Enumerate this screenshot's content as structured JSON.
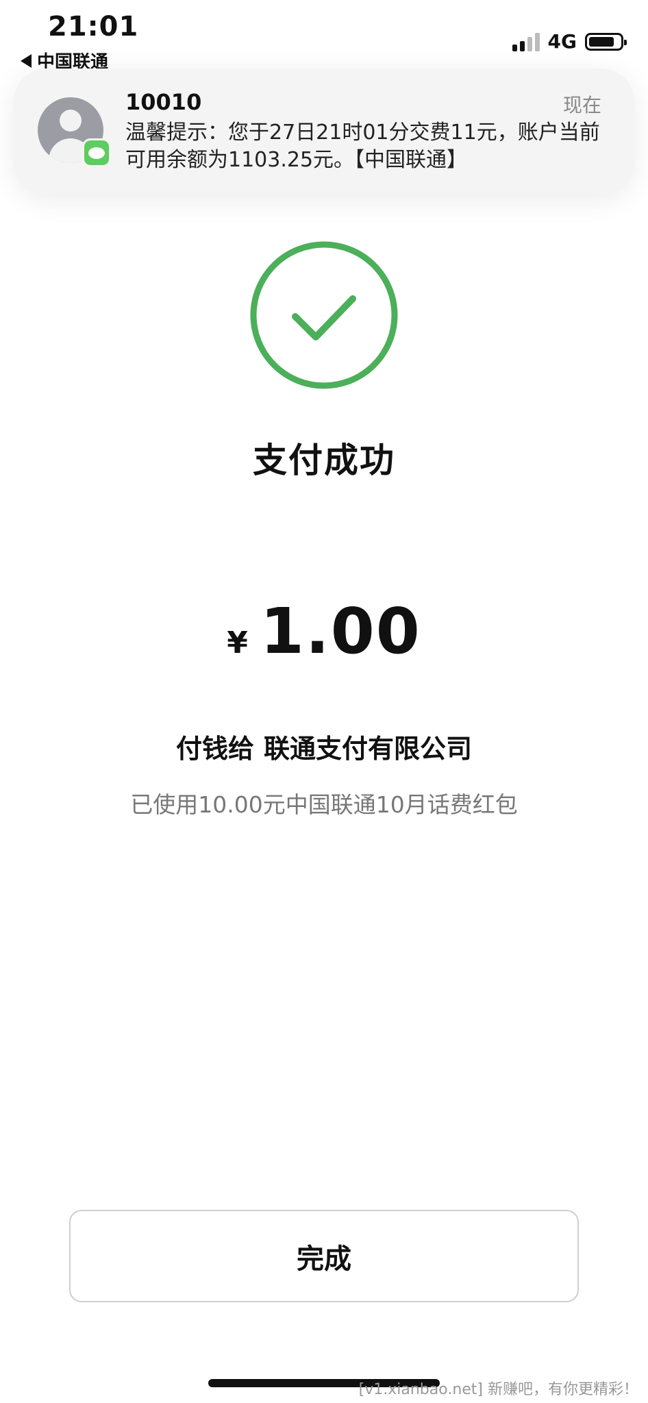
{
  "status_bar": {
    "time": "21:01",
    "back_label": "中国联通",
    "network": "4G"
  },
  "notification": {
    "sender": "10010",
    "time": "现在",
    "body": "温馨提示：您于27日21时01分交费11元，账户当前可用余额为1103.25元。【中国联通】"
  },
  "result": {
    "title": "支付成功",
    "currency": "¥",
    "amount": "1.00",
    "payee_prefix": "付钱给",
    "payee_name": "联通支付有限公司",
    "discount_note": "已使用10.00元中国联通10月话费红包"
  },
  "actions": {
    "done_label": "完成"
  },
  "watermark": "[v1.xianbao.net] 新赚吧，有你更精彩！",
  "colors": {
    "success_green": "#4caf59",
    "message_green": "#5ccd5e"
  }
}
